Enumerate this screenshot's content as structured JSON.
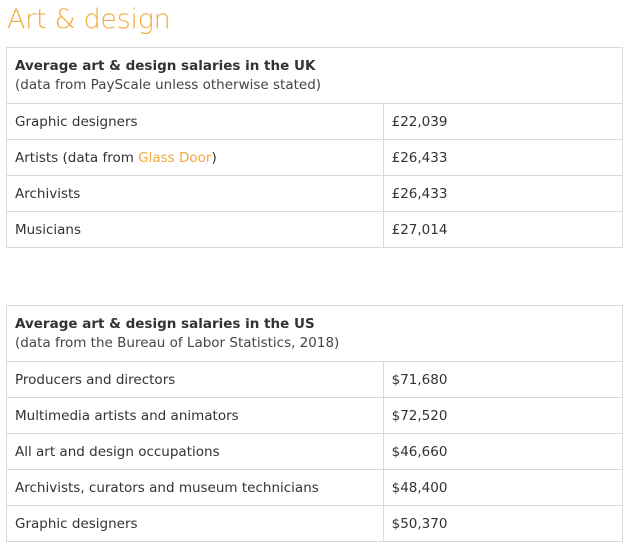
{
  "heading": "Art & design",
  "uk": {
    "title": "Average art & design salaries in the UK",
    "subtitle": "(data from PayScale unless otherwise stated)",
    "rows": [
      {
        "label": "Graphic designers",
        "value": "£22,039"
      },
      {
        "label_before": "Artists (data from ",
        "link": "Glass Door",
        "label_after": ")",
        "value": "£26,433"
      },
      {
        "label": "Archivists",
        "value": "£26,433"
      },
      {
        "label": "Musicians",
        "value": "£27,014"
      }
    ]
  },
  "us": {
    "title": "Average art & design salaries in the US",
    "subtitle": "(data from the Bureau of Labor Statistics, 2018)",
    "rows": [
      {
        "label": "Producers and directors",
        "value": "$71,680"
      },
      {
        "label": "Multimedia artists and animators",
        "value": "$72,520"
      },
      {
        "label": "All art and design occupations",
        "value": "$46,660"
      },
      {
        "label": "Archivists, curators and museum technicians",
        "value": "$48,400"
      },
      {
        "label": "Graphic designers",
        "value": "$50,370"
      }
    ]
  },
  "colors": {
    "accent": "#f2a93b",
    "border": "#d9d9d9",
    "text": "#333333"
  }
}
